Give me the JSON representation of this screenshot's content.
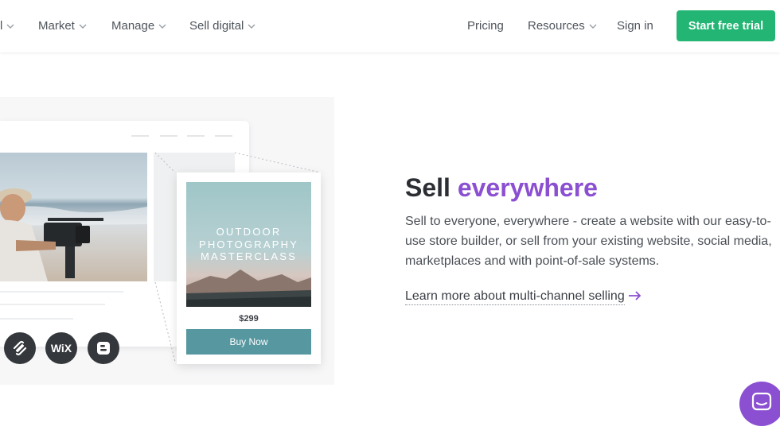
{
  "nav": {
    "partial_item": "l",
    "items": [
      {
        "label": "Market"
      },
      {
        "label": "Manage"
      },
      {
        "label": "Sell digital"
      }
    ],
    "right_items": [
      {
        "label": "Pricing"
      },
      {
        "label": "Resources"
      },
      {
        "label": "Sign in"
      }
    ],
    "cta": "Start free trial"
  },
  "illustration": {
    "poster_title": "OUTDOOR\nPHOTOGRAPHY\nMASTERCLASS",
    "price": "$299",
    "buy_label": "Buy Now",
    "channels": [
      {
        "icon": "squarespace-icon"
      },
      {
        "icon": "wix-icon",
        "label": "WiX"
      },
      {
        "icon": "blogger-icon"
      }
    ]
  },
  "content": {
    "heading_plain": "Sell ",
    "heading_accent": "everywhere",
    "description": "Sell to everyone, everywhere - create a website with our easy-to-use store builder, or sell from your existing website, social media, marketplaces and with point-of-sale systems.",
    "link": "Learn more about multi-channel selling"
  },
  "colors": {
    "brand_green": "#22b573",
    "accent_purple": "#8b4fd1",
    "button_teal": "#57979f"
  }
}
